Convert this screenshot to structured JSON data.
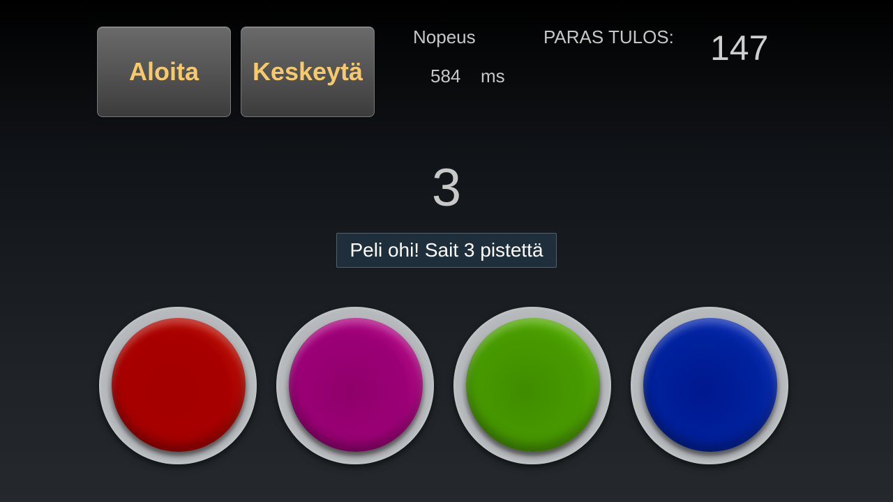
{
  "controls": {
    "start_label": "Aloita",
    "stop_label": "Keskeytä"
  },
  "stats": {
    "speed_label": "Nopeus",
    "speed_value": "584",
    "speed_unit": "ms",
    "best_label": "PARAS TULOS:",
    "best_value": "147"
  },
  "game": {
    "score": "3",
    "toast": "Peli ohi! Sait 3 pistettä"
  },
  "colors": {
    "button_text": "#f6c96c",
    "red": "#a80000",
    "magenta": "#9c0077",
    "green": "#489a00",
    "blue": "#00229e"
  },
  "color_buttons": [
    "red",
    "magenta",
    "green",
    "blue"
  ]
}
